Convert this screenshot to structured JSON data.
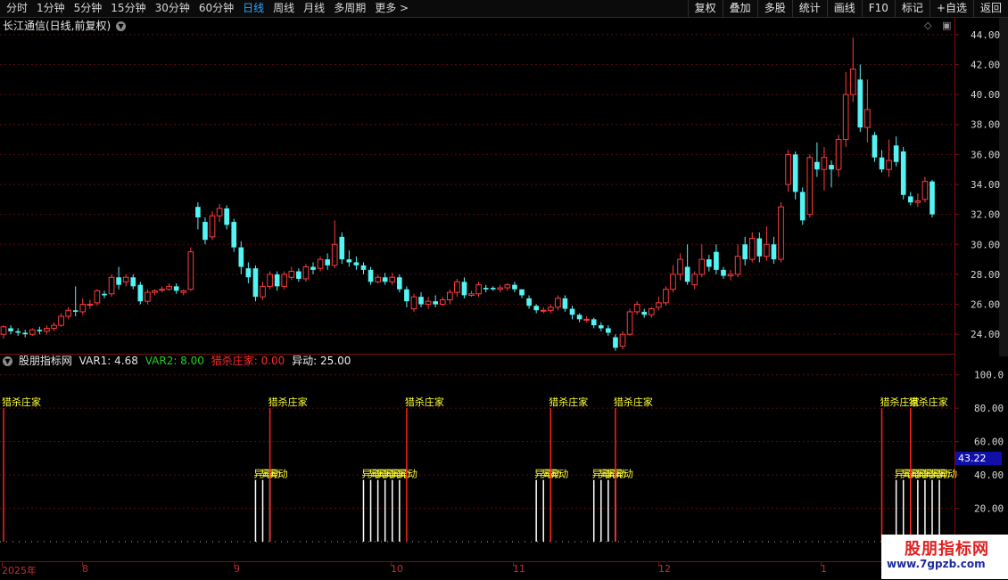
{
  "toolbar": {
    "periods": [
      "分时",
      "1分钟",
      "5分钟",
      "15分钟",
      "30分钟",
      "60分钟",
      "日线",
      "周线",
      "月线",
      "多周期",
      "更多 >"
    ],
    "active_period": "日线",
    "tools": [
      "复权",
      "叠加",
      "多股",
      "统计",
      "画线",
      "F10",
      "标记",
      "+自选",
      "返回"
    ]
  },
  "stock": {
    "title": "长江通信(日线,前复权)"
  },
  "indicator": {
    "name": "股朋指标网",
    "var1": "VAR1: 4.68",
    "var2": "VAR2: 8.00",
    "hunt": "猎杀庄家: 0.00",
    "move": "异动: 25.00",
    "colors": {
      "var1": "#e6e6e6",
      "var2": "#1fd01f",
      "hunt": "#ff2a2a",
      "move": "#f0f0f0"
    },
    "highlight_value": "43.22",
    "signal_label": "猎杀庄家",
    "move_label": "异动"
  },
  "price_axis": [
    "44.00",
    "42.00",
    "40.00",
    "38.00",
    "36.00",
    "34.00",
    "32.00",
    "30.00",
    "28.00",
    "26.00",
    "24.00"
  ],
  "ind_axis": [
    "100.0",
    "80.00",
    "60.00",
    "40.00",
    "20.00"
  ],
  "date_axis": [
    "2025年",
    "8",
    "9",
    "10",
    "11",
    "12",
    "1"
  ],
  "colors": {
    "up": "#ff3c3c",
    "down": "#54f4f4",
    "grid": "#5a0c0c",
    "signal": "#ff2020",
    "label_yellow": "#ffff30",
    "bar_white": "#ffffff"
  },
  "watermark": {
    "line1": "股朋指标网",
    "line2": "www.7gpzb.com"
  },
  "chart_data": {
    "type": "candlestick",
    "title": "长江通信(日线,前复权)",
    "ylim": [
      23,
      45
    ],
    "candles": [
      [
        24.0,
        24.5,
        23.7,
        24.6
      ],
      [
        24.4,
        24.2,
        24.0,
        24.6
      ],
      [
        24.2,
        24.1,
        23.9,
        24.4
      ],
      [
        24.1,
        24.0,
        23.8,
        24.3
      ],
      [
        24.0,
        24.3,
        23.9,
        24.4
      ],
      [
        24.3,
        24.2,
        24.0,
        24.5
      ],
      [
        24.2,
        24.4,
        24.0,
        24.6
      ],
      [
        24.4,
        24.6,
        24.2,
        24.8
      ],
      [
        24.6,
        25.2,
        24.5,
        25.4
      ],
      [
        25.2,
        25.6,
        25.0,
        25.8
      ],
      [
        25.6,
        25.5,
        25.2,
        27.2
      ],
      [
        25.5,
        26.0,
        25.3,
        26.4
      ],
      [
        26.0,
        26.0,
        25.7,
        26.3
      ],
      [
        26.1,
        26.9,
        25.9,
        27.0
      ],
      [
        26.7,
        26.6,
        26.4,
        26.9
      ],
      [
        26.7,
        27.8,
        26.5,
        28.0
      ],
      [
        27.8,
        27.3,
        27.0,
        28.5
      ],
      [
        27.5,
        27.8,
        27.2,
        28.0
      ],
      [
        27.8,
        27.2,
        27.0,
        28.0
      ],
      [
        27.3,
        26.2,
        26.0,
        27.5
      ],
      [
        26.2,
        26.8,
        26.0,
        27.0
      ],
      [
        26.8,
        26.9,
        26.6,
        27.0
      ],
      [
        27.0,
        27.0,
        26.8,
        27.2
      ],
      [
        27.0,
        27.2,
        26.9,
        27.4
      ],
      [
        27.2,
        26.9,
        26.7,
        27.4
      ],
      [
        26.8,
        26.9,
        26.6,
        27.0
      ],
      [
        27.0,
        29.5,
        26.9,
        29.8
      ],
      [
        32.5,
        31.8,
        31.0,
        32.8
      ],
      [
        31.5,
        30.3,
        30.0,
        31.8
      ],
      [
        30.5,
        31.9,
        30.3,
        32.2
      ],
      [
        31.9,
        32.4,
        31.5,
        32.7
      ],
      [
        32.4,
        31.3,
        31.0,
        32.6
      ],
      [
        31.5,
        29.8,
        29.5,
        31.7
      ],
      [
        29.8,
        28.5,
        28.0,
        30.2
      ],
      [
        28.4,
        27.8,
        27.4,
        28.8
      ],
      [
        28.4,
        26.5,
        26.2,
        28.6
      ],
      [
        26.5,
        27.2,
        26.3,
        27.5
      ],
      [
        27.2,
        28.0,
        27.0,
        28.2
      ],
      [
        28.0,
        27.2,
        26.9,
        28.2
      ],
      [
        27.2,
        28.0,
        27.0,
        28.2
      ],
      [
        27.8,
        28.2,
        27.6,
        28.5
      ],
      [
        28.2,
        27.7,
        27.5,
        28.4
      ],
      [
        27.7,
        28.5,
        27.5,
        28.7
      ],
      [
        28.5,
        28.3,
        28.0,
        28.8
      ],
      [
        28.4,
        29.0,
        28.2,
        29.2
      ],
      [
        29.0,
        28.6,
        28.3,
        29.4
      ],
      [
        28.6,
        30.0,
        28.4,
        31.6
      ],
      [
        30.5,
        29.0,
        28.7,
        30.8
      ],
      [
        29.0,
        28.8,
        28.5,
        29.6
      ],
      [
        28.8,
        28.6,
        28.3,
        29.2
      ],
      [
        28.6,
        28.3,
        28.0,
        28.8
      ],
      [
        28.3,
        27.5,
        27.3,
        28.5
      ],
      [
        27.5,
        27.8,
        27.4,
        28.0
      ],
      [
        27.8,
        27.5,
        27.3,
        28.1
      ],
      [
        27.5,
        27.8,
        27.3,
        28.1
      ],
      [
        27.8,
        27.0,
        26.8,
        28.0
      ],
      [
        27.0,
        26.2,
        25.8,
        27.2
      ],
      [
        25.7,
        26.5,
        25.5,
        26.7
      ],
      [
        26.5,
        26.0,
        25.8,
        26.8
      ],
      [
        26.0,
        26.2,
        25.7,
        26.5
      ],
      [
        26.2,
        26.0,
        25.8,
        26.6
      ],
      [
        26.0,
        26.3,
        25.9,
        26.5
      ],
      [
        26.3,
        26.8,
        26.0,
        27.0
      ],
      [
        26.8,
        27.5,
        26.5,
        27.7
      ],
      [
        27.5,
        26.6,
        26.4,
        27.8
      ],
      [
        26.6,
        26.7,
        26.5,
        26.9
      ],
      [
        26.7,
        27.3,
        26.5,
        27.5
      ],
      [
        27.1,
        27.0,
        26.8,
        27.3
      ],
      [
        27.1,
        27.0,
        26.9,
        27.2
      ],
      [
        27.0,
        27.1,
        26.8,
        27.3
      ],
      [
        27.1,
        27.3,
        26.9,
        27.4
      ],
      [
        27.3,
        27.0,
        26.8,
        27.5
      ],
      [
        27.0,
        26.6,
        26.4,
        27.0
      ],
      [
        26.4,
        25.9,
        25.7,
        26.6
      ],
      [
        25.9,
        25.6,
        25.4,
        26.0
      ],
      [
        25.6,
        25.6,
        25.4,
        25.8
      ],
      [
        25.6,
        25.8,
        25.4,
        26.0
      ],
      [
        25.8,
        26.4,
        25.6,
        26.6
      ],
      [
        26.4,
        25.7,
        25.5,
        26.6
      ],
      [
        25.7,
        25.3,
        25.0,
        25.9
      ],
      [
        25.3,
        25.0,
        24.8,
        25.4
      ],
      [
        25.0,
        25.0,
        24.8,
        25.2
      ],
      [
        25.0,
        24.6,
        24.4,
        25.1
      ],
      [
        24.6,
        24.4,
        24.2,
        24.8
      ],
      [
        24.4,
        24.1,
        23.9,
        24.6
      ],
      [
        23.8,
        23.1,
        22.9,
        24.0
      ],
      [
        23.2,
        24.0,
        23.0,
        24.2
      ],
      [
        24.0,
        25.5,
        23.9,
        25.7
      ],
      [
        25.5,
        26.0,
        25.3,
        26.2
      ],
      [
        25.5,
        25.3,
        25.1,
        25.7
      ],
      [
        25.3,
        25.7,
        25.1,
        25.8
      ],
      [
        25.8,
        26.1,
        25.6,
        26.5
      ],
      [
        26.1,
        27.0,
        25.9,
        27.2
      ],
      [
        27.0,
        28.0,
        26.8,
        28.6
      ],
      [
        28.0,
        29.0,
        27.6,
        29.4
      ],
      [
        28.5,
        27.5,
        27.3,
        30.0
      ],
      [
        27.3,
        28.0,
        27.0,
        28.2
      ],
      [
        28.0,
        29.0,
        27.8,
        30.0
      ],
      [
        29.0,
        28.5,
        28.2,
        29.3
      ],
      [
        29.5,
        28.3,
        28.0,
        30.0
      ],
      [
        28.3,
        27.9,
        27.7,
        28.5
      ],
      [
        27.9,
        28.0,
        27.6,
        28.3
      ],
      [
        28.0,
        29.2,
        27.8,
        30.0
      ],
      [
        30.0,
        29.0,
        28.6,
        30.5
      ],
      [
        29.0,
        30.4,
        28.8,
        30.8
      ],
      [
        30.4,
        29.2,
        28.8,
        30.8
      ],
      [
        29.2,
        30.0,
        28.9,
        31.2
      ],
      [
        30.0,
        29.0,
        28.7,
        30.5
      ],
      [
        29.0,
        32.5,
        28.8,
        32.8
      ],
      [
        34.0,
        36.0,
        33.5,
        36.3
      ],
      [
        36.0,
        33.5,
        33.0,
        36.2
      ],
      [
        33.5,
        31.6,
        31.3,
        33.8
      ],
      [
        32.0,
        35.8,
        31.8,
        36.0
      ],
      [
        35.5,
        35.0,
        34.5,
        36.8
      ],
      [
        35.0,
        35.8,
        33.6,
        36.5
      ],
      [
        35.3,
        35.0,
        33.8,
        35.6
      ],
      [
        35.0,
        37.0,
        34.5,
        37.3
      ],
      [
        37.0,
        40.0,
        36.5,
        41.5
      ],
      [
        40.0,
        41.7,
        39.5,
        43.8
      ],
      [
        41.0,
        37.8,
        37.5,
        42.0
      ],
      [
        37.8,
        39.0,
        36.8,
        41.0
      ],
      [
        37.3,
        35.8,
        35.5,
        37.5
      ],
      [
        35.8,
        35.0,
        34.8,
        36.3
      ],
      [
        35.0,
        35.6,
        34.5,
        37.0
      ],
      [
        36.6,
        35.5,
        35.2,
        37.2
      ],
      [
        36.2,
        33.3,
        33.0,
        36.5
      ],
      [
        33.2,
        32.8,
        32.6,
        33.5
      ],
      [
        32.8,
        32.9,
        32.5,
        33.4
      ],
      [
        33.0,
        34.2,
        32.8,
        34.5
      ],
      [
        34.2,
        32.0,
        31.8,
        34.3
      ]
    ],
    "signal_strength": [
      80,
      0,
      0,
      0,
      0,
      0,
      0,
      0,
      0,
      0,
      0,
      0,
      0,
      0,
      0,
      0,
      0,
      0,
      0,
      0,
      0,
      0,
      0,
      0,
      0,
      0,
      0,
      0,
      0,
      0,
      0,
      0,
      0,
      0,
      0,
      0,
      0,
      80,
      0,
      0,
      0,
      0,
      0,
      0,
      0,
      0,
      0,
      0,
      0,
      0,
      0,
      0,
      0,
      0,
      0,
      0,
      80,
      0,
      0,
      0,
      0,
      0,
      0,
      0,
      0,
      0,
      0,
      0,
      0,
      0,
      0,
      0,
      0,
      0,
      0,
      0,
      80,
      0,
      0,
      0,
      0,
      0,
      0,
      0,
      0,
      80,
      0,
      0,
      0,
      0,
      0,
      0,
      0,
      0,
      0,
      0,
      0,
      0,
      0,
      0,
      0,
      0,
      0,
      0,
      0,
      0,
      0,
      0,
      0,
      0,
      0,
      0,
      0,
      0,
      0,
      0,
      0,
      0,
      0,
      0,
      0,
      0,
      80,
      0,
      0,
      0,
      80,
      0,
      0,
      0
    ],
    "move_strength": [
      0,
      0,
      0,
      0,
      0,
      0,
      0,
      0,
      0,
      0,
      0,
      0,
      0,
      0,
      0,
      0,
      0,
      0,
      0,
      0,
      0,
      0,
      0,
      0,
      0,
      0,
      0,
      0,
      0,
      0,
      0,
      0,
      0,
      0,
      0,
      25,
      25,
      25,
      0,
      0,
      0,
      0,
      0,
      0,
      0,
      0,
      0,
      0,
      0,
      0,
      25,
      25,
      25,
      25,
      25,
      25,
      0,
      0,
      0,
      0,
      0,
      0,
      0,
      0,
      0,
      0,
      0,
      0,
      0,
      0,
      0,
      0,
      0,
      0,
      25,
      25,
      25,
      0,
      0,
      0,
      0,
      0,
      25,
      25,
      25,
      25,
      0,
      0,
      0,
      0,
      0,
      0,
      0,
      0,
      0,
      0,
      0,
      0,
      0,
      0,
      0,
      0,
      0,
      0,
      0,
      0,
      0,
      0,
      0,
      0,
      0,
      0,
      0,
      0,
      0,
      0,
      0,
      0,
      0,
      0,
      0,
      0,
      0,
      0,
      25,
      25,
      25,
      25,
      25,
      25,
      25,
      0,
      0,
      0,
      0,
      0,
      0,
      0,
      0,
      0
    ],
    "ind_ylim": [
      0,
      110
    ]
  }
}
